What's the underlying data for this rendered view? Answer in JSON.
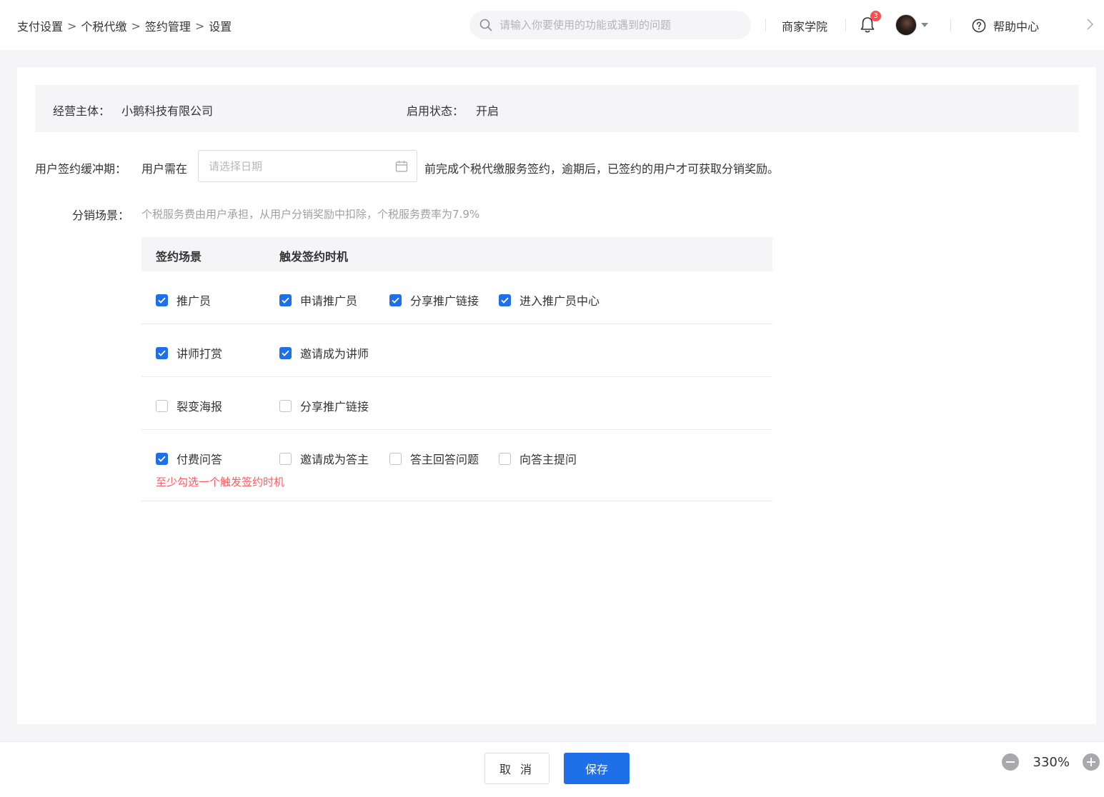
{
  "header": {
    "breadcrumb": [
      "支付设置",
      "个税代缴",
      "签约管理",
      "设置"
    ],
    "breadcrumb_sep": ">",
    "search_placeholder": "请输入你要使用的功能或遇到的问题",
    "academy": "商家学院",
    "notification_count": "3",
    "help": "帮助中心"
  },
  "info": {
    "entity_label": "经营主体：",
    "entity_value": "小鹅科技有限公司",
    "status_label": "启用状态：",
    "status_value": "开启"
  },
  "buffer": {
    "label": "用户签约缓冲期：",
    "prefix": "用户需在",
    "date_placeholder": "请选择日期",
    "suffix": "前完成个税代缴服务签约，逾期后，已签约的用户才可获取分销奖励。"
  },
  "scene": {
    "label": "分销场景：",
    "hint": "个税服务费由用户承担，从用户分销奖励中扣除，个税服务费率为7.9%"
  },
  "table": {
    "col_scene": "签约场景",
    "col_trigger": "触发签约时机",
    "rows": [
      {
        "scene": {
          "label": "推广员",
          "checked": true
        },
        "triggers": [
          {
            "label": "申请推广员",
            "checked": true
          },
          {
            "label": "分享推广链接",
            "checked": true
          },
          {
            "label": "进入推广员中心",
            "checked": true
          }
        ]
      },
      {
        "scene": {
          "label": "讲师打赏",
          "checked": true
        },
        "triggers": [
          {
            "label": "邀请成为讲师",
            "checked": true
          }
        ]
      },
      {
        "scene": {
          "label": "裂变海报",
          "checked": false
        },
        "triggers": [
          {
            "label": "分享推广链接",
            "checked": false
          }
        ]
      },
      {
        "scene": {
          "label": "付费问答",
          "checked": true
        },
        "triggers": [
          {
            "label": "邀请成为答主",
            "checked": false
          },
          {
            "label": "答主回答问题",
            "checked": false
          },
          {
            "label": "向答主提问",
            "checked": false
          }
        ],
        "error": "至少勾选一个触发签约时机"
      }
    ]
  },
  "footer": {
    "cancel": "取 消",
    "save": "保存",
    "zoom": "330%"
  },
  "colors": {
    "primary": "#1e6fe8",
    "error": "#ff5a5f",
    "panel": "#f5f5f7"
  }
}
